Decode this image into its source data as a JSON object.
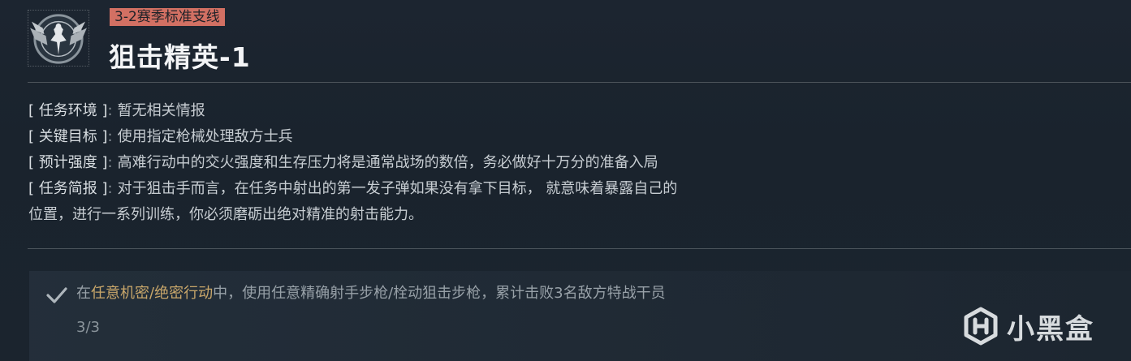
{
  "header": {
    "badge": "3-2赛季标准支线",
    "title": "狙击精英-1",
    "emblem_icon": "eagle-emblem-icon"
  },
  "info": {
    "environment": {
      "key": "[ 任务环境 ]",
      "sep": ":",
      "value": "暂无相关情报"
    },
    "target": {
      "key": "[ 关键目标 ]",
      "sep": ":",
      "value": "使用指定枪械处理敌方士兵"
    },
    "intensity": {
      "key": "[ 预计强度 ]",
      "sep": ":",
      "value": "高难行动中的交火强度和生存压力将是通常战场的数倍，务必做好十万分的准备入局"
    },
    "briefing": {
      "key": "[ 任务简报 ]",
      "sep": ":",
      "value_line1": "对于狙击手而言，在任务中射出的第一发子弹如果没有拿下目标，  就意味着暴露自己的",
      "value_line2": "位置，进行一系列训练，你必须磨砺出绝对精准的射击能力。"
    }
  },
  "objective": {
    "prefix": "在",
    "highlight": "任意机密/绝密行动",
    "suffix": "中，使用任意精确射手步枪/栓动狙击步枪，累计击败3名敌方特战干员",
    "progress": "3/3",
    "completed": true,
    "highlight_color": "#c9a76a"
  },
  "watermark": {
    "text": "小黑盒",
    "icon": "heybox-logo-icon"
  },
  "colors": {
    "badge_bg": "#d27063",
    "background": "#1c2530"
  }
}
